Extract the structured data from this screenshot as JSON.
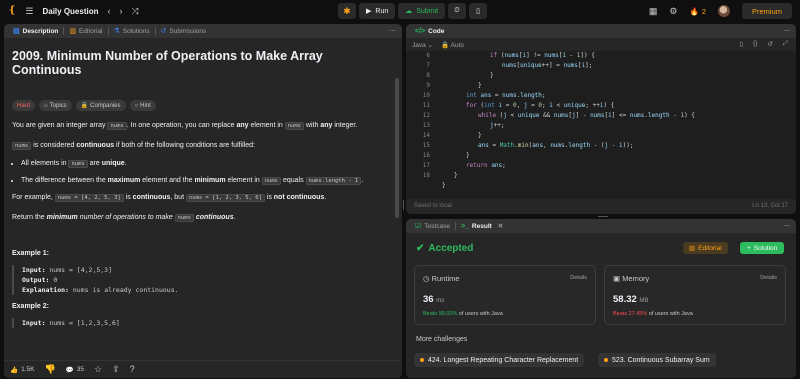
{
  "topbar": {
    "title": "Daily Question",
    "run": "Run",
    "submit": "Submit",
    "streak": "2",
    "premium": "Premium"
  },
  "desc": {
    "tabs": [
      "Description",
      "Editorial",
      "Solutions",
      "Submissions"
    ],
    "title": "2009. Minimum Number of Operations to Make Array Continuous",
    "chips": [
      "Hard",
      "Topics",
      "Companies",
      "Hint"
    ],
    "p1": [
      "You are given an integer array ",
      "nums",
      ". In one operation, you can replace ",
      "any",
      " element in ",
      "nums",
      " with ",
      "any",
      " integer."
    ],
    "p2": [
      "nums",
      " is considered ",
      "continuous",
      " if both of the following conditions are fulfilled:"
    ],
    "b1": [
      "All elements in ",
      "nums",
      " are ",
      "unique",
      "."
    ],
    "b2": [
      "The difference between the ",
      "maximum",
      " element and the ",
      "minimum",
      " element in ",
      "nums",
      " equals ",
      "nums.length - 1",
      "."
    ],
    "p3": [
      "For example, ",
      "nums = [4, 2, 5, 3]",
      " is ",
      "continuous",
      ", but ",
      "nums = [1, 2, 3, 5, 6]",
      " is ",
      "not continuous",
      "."
    ],
    "p4": [
      "Return the ",
      "minimum",
      " number of operations",
      " to make ",
      "nums",
      " continuous",
      "."
    ],
    "ex1": {
      "h": "Example 1:",
      "input_k": "Input:",
      "input_v": " nums = [4,2,5,3]",
      "output_k": "Output:",
      "output_v": " 0",
      "expl_k": "Explanation:",
      "expl_v": " nums is already continuous."
    },
    "ex2": {
      "h": "Example 2:",
      "input_k": "Input:",
      "input_v": " nums = [1,2,3,5,6]"
    },
    "footer": {
      "likes": "1.5K",
      "comments": "35"
    }
  },
  "code": {
    "tab": "Code",
    "lang": "Java",
    "auto": "Auto",
    "saved": "Saved to local",
    "cursor": "Ln 13, Col 17",
    "line_numbers": [
      "6",
      "7",
      "8",
      "9",
      "10",
      "11",
      "12",
      "13",
      "14",
      "15",
      "16",
      "17",
      "18"
    ]
  },
  "result": {
    "tabs": [
      "Testcase",
      "Result"
    ],
    "status": "Accepted",
    "editorial": "Editorial",
    "solution": "Solution",
    "runtime": {
      "label": "Runtime",
      "details": "Details",
      "value": "36",
      "unit": "ms",
      "beats_pct": "Beats 99.02%",
      "beats_rest": " of users with Java"
    },
    "memory": {
      "label": "Memory",
      "details": "Details",
      "value": "58.32",
      "unit": "MB",
      "beats_pct": "Beats 27.45%",
      "beats_rest": " of users with Java"
    },
    "more": "More challenges",
    "challenges": [
      "424. Longest Repeating Character Replacement",
      "523. Continuous Subarray Sum"
    ]
  },
  "colors": {
    "accent": "#ffa116",
    "green": "#2cbb5d",
    "hard": "#ff6060",
    "red": "#ff4d4f"
  }
}
